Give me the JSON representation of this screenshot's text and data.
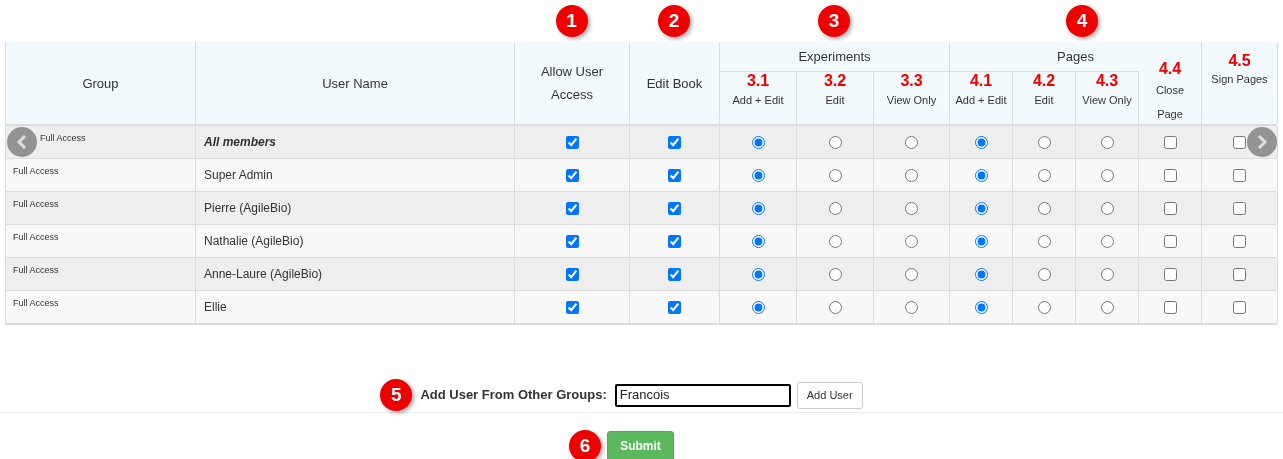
{
  "column_groups": [
    {
      "label": "Experiments",
      "badge": "3"
    },
    {
      "label": "Pages",
      "badge": "4"
    }
  ],
  "columns": [
    {
      "label": "Group"
    },
    {
      "label": "User Name"
    },
    {
      "label": "Allow User Access",
      "badge": "1"
    },
    {
      "label": "Edit Book",
      "badge": "2"
    },
    {
      "code": "3.1",
      "label": "Add + Edit"
    },
    {
      "code": "3.2",
      "label": "Edit"
    },
    {
      "code": "3.3",
      "label": "View Only"
    },
    {
      "code": "4.1",
      "label": "Add + Edit"
    },
    {
      "code": "4.2",
      "label": "Edit"
    },
    {
      "code": "4.3",
      "label": "View Only"
    },
    {
      "code": "4.4",
      "label": "Close Page"
    },
    {
      "code": "4.5",
      "label": "Sign Pages"
    }
  ],
  "rows": [
    {
      "kind": "all_members",
      "group": "Full Access",
      "user_name": "All members",
      "allow_user_access": true,
      "edit_book": true,
      "experiments": [
        {
          "selected": true
        },
        {
          "selected": false
        },
        {
          "selected": false
        }
      ],
      "pages": [
        {
          "selected": true
        },
        {
          "selected": false
        },
        {
          "selected": false
        }
      ],
      "close_page": false,
      "sign_pages": false
    },
    {
      "kind": "user",
      "group": "Full Access",
      "user_name": "Super Admin",
      "allow_user_access": true,
      "edit_book": true,
      "experiments": [
        {
          "selected": true
        },
        {
          "selected": false
        },
        {
          "selected": false
        }
      ],
      "pages": [
        {
          "selected": true
        },
        {
          "selected": false
        },
        {
          "selected": false
        }
      ],
      "close_page": false,
      "sign_pages": false
    },
    {
      "kind": "user",
      "group": "Full Access",
      "user_name": "Pierre (AgileBio)",
      "allow_user_access": true,
      "edit_book": true,
      "experiments": [
        {
          "selected": true
        },
        {
          "selected": false
        },
        {
          "selected": false
        }
      ],
      "pages": [
        {
          "selected": true
        },
        {
          "selected": false
        },
        {
          "selected": false
        }
      ],
      "close_page": false,
      "sign_pages": false
    },
    {
      "kind": "user",
      "group": "Full Access",
      "user_name": "Nathalie (AgileBio)",
      "allow_user_access": true,
      "edit_book": true,
      "experiments": [
        {
          "selected": true
        },
        {
          "selected": false
        },
        {
          "selected": false
        }
      ],
      "pages": [
        {
          "selected": true
        },
        {
          "selected": false
        },
        {
          "selected": false
        }
      ],
      "close_page": false,
      "sign_pages": false
    },
    {
      "kind": "user",
      "group": "Full Access",
      "user_name": "Anne-Laure (AgileBio)",
      "allow_user_access": true,
      "edit_book": true,
      "experiments": [
        {
          "selected": true
        },
        {
          "selected": false
        },
        {
          "selected": false
        }
      ],
      "pages": [
        {
          "selected": true
        },
        {
          "selected": false
        },
        {
          "selected": false
        }
      ],
      "close_page": false,
      "sign_pages": false
    },
    {
      "kind": "user",
      "group": "Full Access",
      "user_name": "Ellie",
      "allow_user_access": true,
      "edit_book": true,
      "experiments": [
        {
          "selected": true
        },
        {
          "selected": false
        },
        {
          "selected": false
        }
      ],
      "pages": [
        {
          "selected": true
        },
        {
          "selected": false
        },
        {
          "selected": false
        }
      ],
      "close_page": false,
      "sign_pages": false
    }
  ],
  "add_user": {
    "badge": "5",
    "label": "Add User From Other Groups:",
    "value": "Francois",
    "button": "Add User"
  },
  "submit": {
    "badge": "6",
    "label": "Submit"
  }
}
